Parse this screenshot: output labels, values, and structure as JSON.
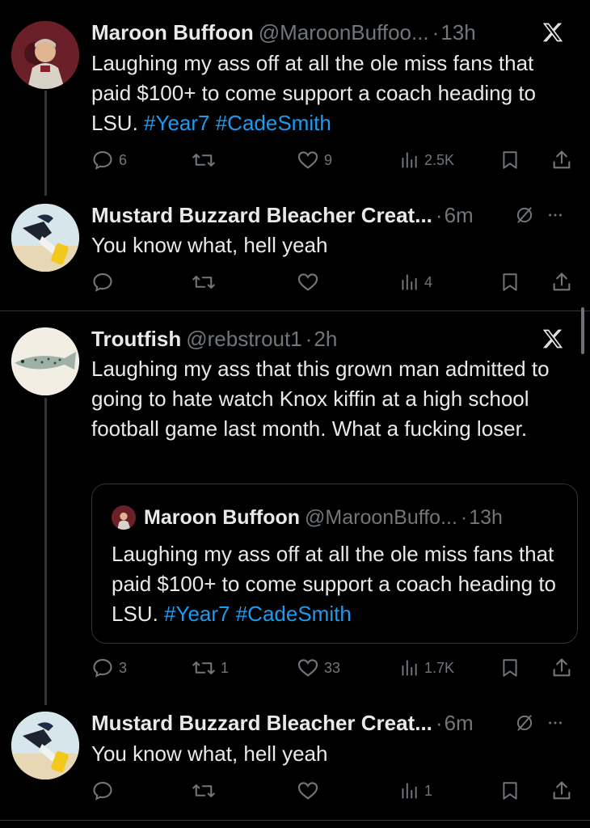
{
  "tweets": [
    {
      "name": "Maroon Buffoon",
      "handle": "@MaroonBuffoo...",
      "time": "13h",
      "text_parts": [
        "Laughing my ass off at all the ole miss fans that paid $100+ to come support a coach heading to LSU. ",
        "#Year7",
        " ",
        "#CadeSmith"
      ],
      "counts": {
        "replies": "6",
        "retweets": "",
        "likes": "9",
        "views": "2.5K"
      },
      "head_icon": "x-logo-icon"
    },
    {
      "name": "Mustard Buzzard Bleacher Creat...",
      "time": "6m",
      "text": "You know what, hell yeah",
      "counts": {
        "replies": "",
        "retweets": "",
        "likes": "",
        "views": "4"
      },
      "head_icon": "muted-icon"
    },
    {
      "name": "Troutfish",
      "handle": "@rebstrout1",
      "time": "2h",
      "text": "Laughing my ass that this grown man admitted to going to hate watch Knox kiffin at a high school football game last month. What a fucking loser.",
      "quote": {
        "name": "Maroon Buffoon",
        "handle": "@MaroonBuffo...",
        "time": "13h",
        "text_parts": [
          "Laughing my ass off at all the ole miss fans that paid $100+ to come support a coach heading to LSU. ",
          "#Year7",
          " ",
          "#CadeSmith"
        ]
      },
      "counts": {
        "replies": "3",
        "retweets": "1",
        "likes": "33",
        "views": "1.7K"
      },
      "head_icon": "x-logo-icon"
    },
    {
      "name": "Mustard Buzzard Bleacher Creat...",
      "time": "6m",
      "text": "You know what, hell yeah",
      "counts": {
        "replies": "",
        "retweets": "",
        "likes": "",
        "views": "1"
      },
      "head_icon": "muted-icon"
    }
  ],
  "separator": "·",
  "colors": {
    "background": "#000000",
    "text": "#e7e9ea",
    "secondary": "#71767b",
    "link": "#1d9bf0",
    "border": "#2f3336"
  }
}
